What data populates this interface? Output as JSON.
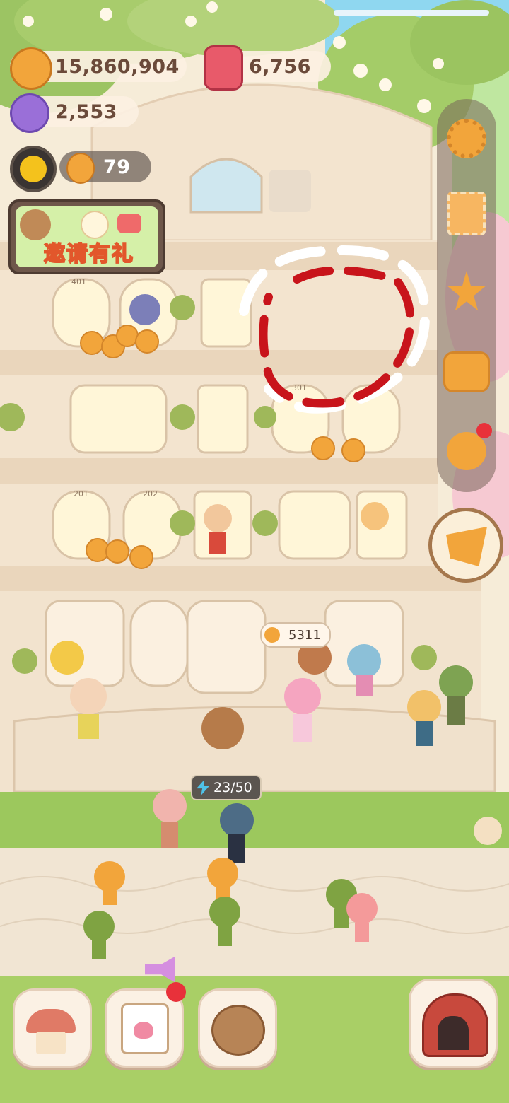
{
  "resources": {
    "cookies": "15,860,904",
    "gems": "6,756",
    "candy": "2,553",
    "workers": "79"
  },
  "invite_banner": {
    "label": "邀请有礼"
  },
  "shop_counter": {
    "value": "5311"
  },
  "energy_badge": {
    "value": "23/50"
  },
  "room_numbers": [
    "401",
    "301",
    "201",
    "202"
  ],
  "colors": {
    "sky": "#8fd7f0",
    "building": "#f3e4cf",
    "grass": "#9cc85d",
    "path": "#f1e5d3",
    "accent_red": "#c8141b",
    "cookie": "#f2a53b"
  },
  "icons": {
    "settings": "gear-icon",
    "profile_card": "profile-card-icon",
    "achievement": "star-medal-icon",
    "bag": "backpack-icon",
    "friends": "friends-icon",
    "event": "cake-slice-icon",
    "build": "mushroom-house-icon",
    "diary": "heart-calendar-icon",
    "recipes": "cookie-plate-icon",
    "theater": "carousel-stage-icon",
    "announce": "megaphone-icon"
  }
}
